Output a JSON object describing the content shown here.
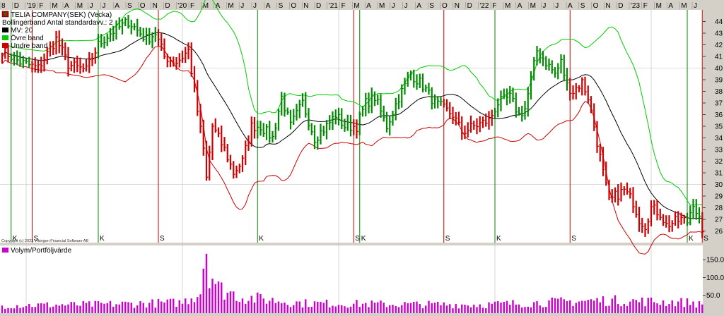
{
  "chart_data": {
    "type": "ohlc",
    "title": "TELIA COMPANY(SEK) (Vecka)",
    "copyright": "Copyright (c) 2023 Vikingen Financial Software AB",
    "legend": [
      {
        "label": "Bollingerband  Antal standardavv.: 2",
        "color": ""
      },
      {
        "label": "MV: 20",
        "color": "#000000"
      },
      {
        "label": "Övre band",
        "color": "#00cc00"
      },
      {
        "label": "Undre band",
        "color": "#cc0000"
      }
    ],
    "x_axis": {
      "years": [
        "'19",
        "'20",
        "'21",
        "'22",
        "'23"
      ],
      "ticks": [
        "8",
        "D",
        "'19",
        "F",
        "M",
        "A",
        "M",
        "J",
        "J",
        "A",
        "S",
        "O",
        "N",
        "D",
        "'20",
        "F",
        "M",
        "A",
        "M",
        "J",
        "J",
        "A",
        "S",
        "O",
        "N",
        "D",
        "'21",
        "F",
        "M",
        "A",
        "M",
        "J",
        "J",
        "A",
        "S",
        "O",
        "N",
        "D",
        "'22",
        "F",
        "M",
        "A",
        "M",
        "J",
        "J",
        "A",
        "S",
        "O",
        "N",
        "D",
        "'23",
        "F",
        "M",
        "A",
        "M",
        "J"
      ]
    },
    "y_axis": {
      "range": [
        25,
        45
      ],
      "ticks": [
        26,
        27,
        28,
        29,
        30,
        31,
        32,
        33,
        34,
        35,
        36,
        37,
        38,
        39,
        40,
        41,
        42,
        43,
        44
      ]
    },
    "volume": {
      "label": "Volym/Portföljvärde",
      "range": [
        0,
        190
      ],
      "ticks": [
        "50.0",
        "100.0",
        "150.0"
      ],
      "color": "#cc00cc"
    },
    "signals": [
      {
        "type": "K",
        "week": 3,
        "color": "#008800"
      },
      {
        "type": "S",
        "week": 10,
        "color": "#cc0000"
      },
      {
        "type": "K",
        "week": 32,
        "color": "#008800"
      },
      {
        "type": "S",
        "week": 52,
        "color": "#cc0000"
      },
      {
        "type": "K",
        "week": 85,
        "color": "#008800"
      },
      {
        "type": "S",
        "week": 117,
        "color": "#cc0000"
      },
      {
        "type": "K",
        "week": 119,
        "color": "#008800"
      },
      {
        "type": "S",
        "week": 147,
        "color": "#cc0000"
      },
      {
        "type": "K",
        "week": 164,
        "color": "#008800"
      },
      {
        "type": "S",
        "week": 189,
        "color": "#cc0000"
      },
      {
        "type": "K",
        "week": 228,
        "color": "#008800"
      },
      {
        "type": "S",
        "week": 233,
        "color": "#cc0000"
      }
    ],
    "price_path": [
      [
        0,
        41.5
      ],
      [
        6,
        40.5
      ],
      [
        12,
        40
      ],
      [
        18,
        42.5
      ],
      [
        22,
        40.3
      ],
      [
        28,
        39.8
      ],
      [
        32,
        42
      ],
      [
        36,
        43
      ],
      [
        42,
        44
      ],
      [
        48,
        42.5
      ],
      [
        51,
        43
      ],
      [
        54,
        41
      ],
      [
        58,
        40.5
      ],
      [
        62,
        41.5
      ],
      [
        64,
        38
      ],
      [
        67,
        33
      ],
      [
        68,
        30.5
      ],
      [
        70,
        35
      ],
      [
        74,
        33
      ],
      [
        77,
        31
      ],
      [
        80,
        32
      ],
      [
        83,
        35
      ],
      [
        86,
        35
      ],
      [
        90,
        34
      ],
      [
        93,
        37.5
      ],
      [
        96,
        35
      ],
      [
        100,
        37
      ],
      [
        104,
        34
      ],
      [
        108,
        35
      ],
      [
        111,
        36
      ],
      [
        114,
        35
      ],
      [
        118,
        35
      ],
      [
        121,
        37
      ],
      [
        124,
        37.5
      ],
      [
        128,
        35
      ],
      [
        132,
        37.5
      ],
      [
        136,
        39.5
      ],
      [
        140,
        38.5
      ],
      [
        144,
        37
      ],
      [
        147,
        36.5
      ],
      [
        150,
        36
      ],
      [
        153,
        34.5
      ],
      [
        157,
        35
      ],
      [
        162,
        35.5
      ],
      [
        165,
        37
      ],
      [
        169,
        37.5
      ],
      [
        172,
        36
      ],
      [
        174,
        36.5
      ],
      [
        176,
        39
      ],
      [
        178,
        41.5
      ],
      [
        181,
        40.5
      ],
      [
        184,
        39.5
      ],
      [
        186,
        40.5
      ],
      [
        188,
        38.5
      ],
      [
        190,
        38
      ],
      [
        193,
        38.8
      ],
      [
        195,
        37.5
      ],
      [
        197,
        35
      ],
      [
        200,
        31
      ],
      [
        202,
        28.5
      ],
      [
        204,
        29
      ],
      [
        207,
        29.5
      ],
      [
        210,
        28.5
      ],
      [
        212,
        27
      ],
      [
        214,
        26.5
      ],
      [
        216,
        28
      ],
      [
        219,
        27.5
      ],
      [
        221,
        26.5
      ],
      [
        224,
        26.8
      ],
      [
        226,
        27
      ],
      [
        228,
        26.8
      ],
      [
        230,
        28.5
      ],
      [
        232,
        27
      ],
      [
        233,
        25.5
      ]
    ],
    "volume_path": [
      [
        0,
        22
      ],
      [
        30,
        24
      ],
      [
        60,
        30
      ],
      [
        66,
        60
      ],
      [
        67,
        150
      ],
      [
        68,
        185
      ],
      [
        69,
        125
      ],
      [
        72,
        70
      ],
      [
        80,
        45
      ],
      [
        100,
        28
      ],
      [
        130,
        25
      ],
      [
        160,
        24
      ],
      [
        200,
        36
      ],
      [
        230,
        30
      ],
      [
        233,
        22
      ]
    ]
  }
}
